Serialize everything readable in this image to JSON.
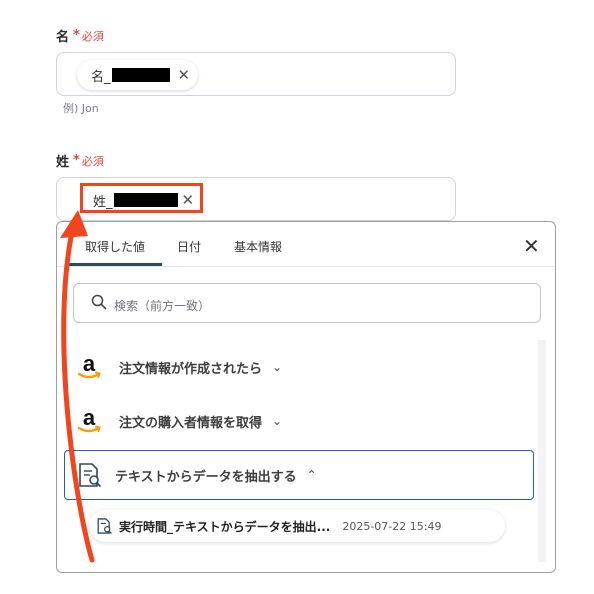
{
  "first_name": {
    "label": "名",
    "required_star": "*",
    "required_text": "必須",
    "chip_text": "名_",
    "chip_remove": "✕",
    "hint": "例) Jon"
  },
  "last_name": {
    "label": "姓",
    "required_star": "*",
    "required_text": "必須",
    "chip_text": "姓_",
    "chip_remove": "✕"
  },
  "panel": {
    "tabs": [
      {
        "label": "取得した値"
      },
      {
        "label": "日付"
      },
      {
        "label": "基本情報"
      }
    ],
    "active_tab": "取得した値",
    "close": "✕",
    "search_placeholder": "検索（前方一致）",
    "items": [
      {
        "label": "注文情報が作成されたら",
        "icon": "amazon-icon",
        "chevron": "⌄"
      },
      {
        "label": "注文の購入者情報を取得",
        "icon": "amazon-icon",
        "chevron": "⌄"
      },
      {
        "label": "テキストからデータを抽出する",
        "icon": "document-search-icon",
        "chevron": "⌃"
      }
    ],
    "sub_item": {
      "label": "実行時間_テキストからデータを抽出...",
      "time": "2025-07-22 15:49"
    }
  },
  "colors": {
    "required": "#e0483e",
    "highlight": "#f0451e",
    "selected_border": "#1d5fb5",
    "amazon_orange": "#ff9900"
  }
}
